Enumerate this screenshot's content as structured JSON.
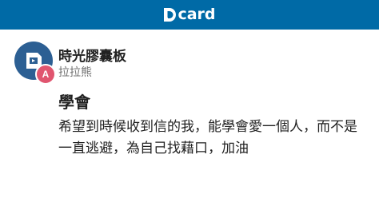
{
  "header": {
    "brand_text": "card",
    "background_color": "#006aa6",
    "logo_icon": "dcard-d-logo-icon"
  },
  "post": {
    "board_name": "時光膠囊板",
    "board_avatar_icon": "board-tag-icon",
    "author": {
      "name": "拉拉熊",
      "avatar_letter": "A",
      "avatar_color": "#e0556f"
    },
    "title": "學會",
    "body": "希望到時候收到信的我，能學會愛一個人，而不是一直逃避，為自己找藉口，加油"
  }
}
